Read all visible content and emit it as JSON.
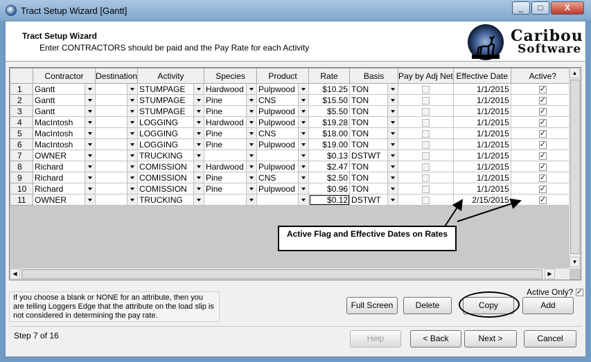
{
  "window": {
    "title": "Tract Setup Wizard [Gantt]",
    "buttons": [
      "_",
      "□",
      "X"
    ]
  },
  "header": {
    "title": "Tract Setup Wizard",
    "subtitle": "Enter CONTRACTORS should be paid and the Pay Rate for each Activity"
  },
  "logo": {
    "line1": "Caribou",
    "line2": "Software"
  },
  "grid": {
    "columns": [
      "Contractor",
      "Destination",
      "Activity",
      "Species",
      "Product",
      "Rate",
      "Basis",
      "Pay by Adj Net",
      "Effective Date",
      "Active?"
    ],
    "rows": [
      {
        "n": "1",
        "contractor": "Gantt",
        "destination": "",
        "activity": "STUMPAGE",
        "species": "Hardwood",
        "product": "Pulpwood",
        "rate": "$10.25",
        "basis": "TON",
        "pay_adj_net": false,
        "effective": "1/1/2015",
        "active": true
      },
      {
        "n": "2",
        "contractor": "Gantt",
        "destination": "",
        "activity": "STUMPAGE",
        "species": "Pine",
        "product": "CNS",
        "rate": "$15.50",
        "basis": "TON",
        "pay_adj_net": false,
        "effective": "1/1/2015",
        "active": true
      },
      {
        "n": "3",
        "contractor": "Gantt",
        "destination": "",
        "activity": "STUMPAGE",
        "species": "Pine",
        "product": "Pulpwood",
        "rate": "$5.50",
        "basis": "TON",
        "pay_adj_net": false,
        "effective": "1/1/2015",
        "active": true
      },
      {
        "n": "4",
        "contractor": "MacIntosh",
        "destination": "",
        "activity": "LOGGING",
        "species": "Hardwood",
        "product": "Pulpwood",
        "rate": "$19.28",
        "basis": "TON",
        "pay_adj_net": false,
        "effective": "1/1/2015",
        "active": true
      },
      {
        "n": "5",
        "contractor": "MacIntosh",
        "destination": "",
        "activity": "LOGGING",
        "species": "Pine",
        "product": "CNS",
        "rate": "$18.00",
        "basis": "TON",
        "pay_adj_net": false,
        "effective": "1/1/2015",
        "active": true
      },
      {
        "n": "6",
        "contractor": "MacIntosh",
        "destination": "",
        "activity": "LOGGING",
        "species": "Pine",
        "product": "Pulpwood",
        "rate": "$19.00",
        "basis": "TON",
        "pay_adj_net": false,
        "effective": "1/1/2015",
        "active": true
      },
      {
        "n": "7",
        "contractor": "OWNER",
        "destination": "",
        "activity": "TRUCKING",
        "species": "",
        "product": "",
        "rate": "$0.13",
        "basis": "DSTWT",
        "pay_adj_net": false,
        "effective": "1/1/2015",
        "active": true
      },
      {
        "n": "8",
        "contractor": "Richard",
        "destination": "",
        "activity": "COMISSION",
        "species": "Hardwood",
        "product": "Pulpwood",
        "rate": "$2.47",
        "basis": "TON",
        "pay_adj_net": false,
        "effective": "1/1/2015",
        "active": true
      },
      {
        "n": "9",
        "contractor": "Richard",
        "destination": "",
        "activity": "COMISSION",
        "species": "Pine",
        "product": "CNS",
        "rate": "$2.50",
        "basis": "TON",
        "pay_adj_net": false,
        "effective": "1/1/2015",
        "active": true
      },
      {
        "n": "10",
        "contractor": "Richard",
        "destination": "",
        "activity": "COMISSION",
        "species": "Pine",
        "product": "Pulpwood",
        "rate": "$0.96",
        "basis": "TON",
        "pay_adj_net": false,
        "effective": "1/1/2015",
        "active": true
      },
      {
        "n": "11",
        "contractor": "OWNER",
        "destination": "",
        "activity": "TRUCKING",
        "species": "",
        "product": "",
        "rate": "$0.12",
        "basis": "DSTWT",
        "pay_adj_net": false,
        "effective": "2/15/2015",
        "active": true
      }
    ]
  },
  "callout": {
    "text": "Active Flag and Effective Dates on Rates"
  },
  "info": {
    "text": "If you choose a blank or NONE for an attribute, then you are telling Loggers Edge that the attribute on the load slip is not considered in determining the pay rate."
  },
  "buttons": {
    "full_screen": "Full Screen",
    "delete": "Delete",
    "copy": "Copy",
    "add": "Add",
    "help": "Help",
    "back": "< Back",
    "next": "Next >",
    "cancel": "Cancel"
  },
  "active_only": {
    "label": "Active Only?",
    "checked": true
  },
  "footer": {
    "step": "Step 7 of 16"
  },
  "colors": {
    "title_bar": "#7ea6cc",
    "grid_empty": "#c9c9c9",
    "close_button": "#c0392b"
  }
}
